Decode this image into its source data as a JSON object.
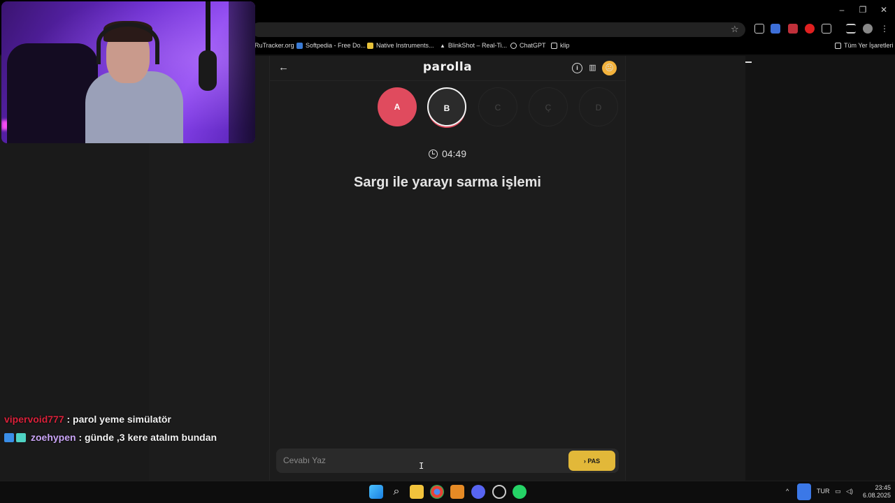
{
  "browser": {
    "bookmarks": [
      {
        "label": "RuTracker.org",
        "color": "#2a6fd6"
      },
      {
        "label": "Softpedia - Free Do...",
        "color": "#3a7bd5"
      },
      {
        "label": "Native Instruments...",
        "color": "#e8c23a"
      },
      {
        "label": "BlinkShot – Real-Ti...",
        "color": "#dddddd"
      },
      {
        "label": "ChatGPT",
        "color": "#dddddd"
      },
      {
        "label": "klip",
        "color": "#dddddd"
      }
    ],
    "all_bookmarks_label": "Tüm Yer İşaretleri",
    "window_controls": {
      "minimize": "–",
      "restore": "❐",
      "close": "✕"
    }
  },
  "app": {
    "logo": "parolla",
    "back_icon": "←",
    "stats_icon": "▥",
    "info_icon": "i",
    "avatar": "😐",
    "letters": [
      {
        "letter": "A",
        "state": "done"
      },
      {
        "letter": "B",
        "state": "active"
      },
      {
        "letter": "C",
        "state": "todo"
      },
      {
        "letter": "Ç",
        "state": "todo"
      },
      {
        "letter": "D",
        "state": "todo"
      }
    ],
    "timer": "04:49",
    "question": "Sargı ile yarayı sarma işlemi",
    "answer": {
      "placeholder": "Cevabı Yaz",
      "value": ""
    },
    "pass_label": "› PAS",
    "colors": {
      "done": "#e04b5e",
      "pass": "#e2b839"
    }
  },
  "chat": [
    {
      "user": "vipervoid777",
      "user_color": "#d9213a",
      "message": " : parol yeme simülatör",
      "badges": []
    },
    {
      "user": "zoehypen",
      "user_color": "#c9a4f5",
      "message": " : günde ,3 kere atalım bundan",
      "badges": [
        "#3a8ee8",
        "#4fd3c4"
      ]
    }
  ],
  "taskbar": {
    "language": "TUR",
    "time": "23:45",
    "date": "6.08.2025",
    "apps": [
      "windows-start-icon",
      "search-icon",
      "file-explorer-icon",
      "chrome-icon",
      "fl-studio-icon",
      "discord-icon",
      "app-icon",
      "whatsapp-icon"
    ]
  }
}
